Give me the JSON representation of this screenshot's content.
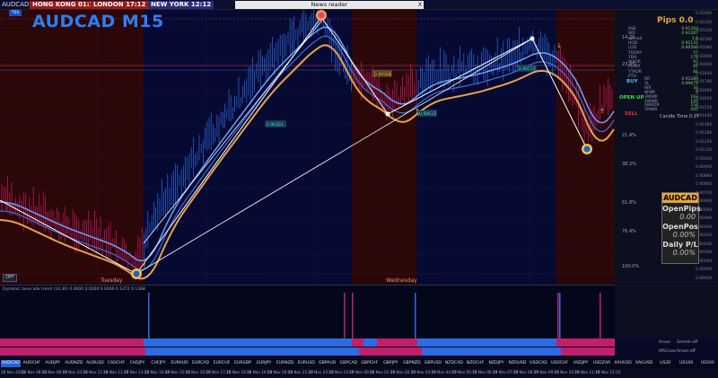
{
  "window": {
    "symbol_label": "AUDCAD,M15",
    "small_tab": "TSS"
  },
  "clocks": {
    "hong_kong": "HONG KONG 01:12",
    "london": "LONDON  17:12",
    "new_york": "NEW YORK  12:12"
  },
  "news": {
    "label": "News reader",
    "close": "X"
  },
  "chart": {
    "title": "AUDCAD M15",
    "day_labels": [
      "Tuesday",
      "Wednesday"
    ],
    "off_button": "OFF",
    "box_labels": [
      "0.90303",
      "0.90568",
      "0.90633",
      "0.90572"
    ],
    "price_ticks": [
      "0.92400",
      "0.92320",
      "0.92240",
      "0.92160",
      "0.92080",
      "0.92000",
      "0.91920",
      "0.91840",
      "0.91760",
      "0.91680",
      "0.91600",
      "0.91520",
      "0.91440",
      "0.91360",
      "0.91280",
      "0.91200",
      "0.91120",
      "0.91040",
      "0.90960",
      "0.90880",
      "0.90800",
      "0.90720",
      "0.90640",
      "0.90560",
      "0.90480",
      "0.90400",
      "0.90320",
      "0.90240",
      "0.90160",
      "0.90080",
      "0.90000",
      "0.89920"
    ],
    "pct_ticks": [
      "14.25",
      "23.4%",
      "21.4%",
      "38.2%",
      "61.8%",
      "76.4%",
      "100.0%"
    ]
  },
  "info_panel": {
    "pips": "Pips 0.0",
    "rows": [
      {
        "k": "ASK",
        "v": "0.91303"
      },
      {
        "k": "BID",
        "v": "0.91287"
      },
      {
        "k": "spread",
        "v": "1.6"
      },
      {
        "k": "HOD",
        "v": "0.91131"
      },
      {
        "k": "LOD",
        "v": "0.90560"
      },
      {
        "k": "TODAY",
        "v": "57"
      },
      {
        "k": "YDR",
        "v": "172"
      },
      {
        "k": "WADR",
        "v": "97"
      },
      {
        "k": "MADR",
        "v": "81"
      },
      {
        "k": "YTADR",
        "v": "81"
      },
      {
        "k": "PTO",
        "v": "--"
      }
    ],
    "sl_rows": [
      {
        "k": "RR",
        "v": "0.91289"
      },
      {
        "k": "SL",
        "v": "0.89672"
      },
      {
        "k": "WR",
        "v": "34"
      },
      {
        "k": "WWR",
        "v": "0"
      },
      {
        "k": "3WWR",
        "v": "163"
      },
      {
        "k": "5WWR",
        "v": "156"
      },
      {
        "k": "SWADR",
        "v": "154"
      },
      {
        "k": "5MWR",
        "v": "205"
      }
    ],
    "signals": {
      "buy": "BUY",
      "open_up": "OPEN UP",
      "sell": "SELL"
    },
    "candle_time_label": "Candle Time",
    "candle_time_value": "0:27"
  },
  "account": {
    "symbol": "AUDCAD",
    "open_pips_label": "OpenPips",
    "open_pips_value": "0.00",
    "open_pos_label": "OpenPos",
    "open_pos_value": "0.00%",
    "daily_pl_label": "Daily P/L",
    "daily_pl_value": "0.00%"
  },
  "indicator": {
    "label": "Dynamic zone adx trend (14,30) 0.0000 0.0000 0.0000 0.1472 0.1388",
    "strip1_label": "Aroon",
    "strip1_right": "Sentek-off",
    "strip2_label": "MACross",
    "strip2_right": "Aroon-off"
  },
  "symbols": [
    "AUDCAD",
    "AUDCHF",
    "AUDJPY",
    "AUDNZD",
    "AUDUSD",
    "CADCHF",
    "CADJPY",
    "CHFJPY",
    "EURAUD",
    "EURCAD",
    "EURCHF",
    "EURGBP",
    "EURJPY",
    "EURNZD",
    "EURUSD",
    "GBPAUD",
    "GBPCAD",
    "GBPCHF",
    "GBPJPY",
    "GBPNZD",
    "GBPUSD",
    "NZDCAD",
    "NZDCHF",
    "NZDJPY",
    "NZDUSD",
    "USDCAD",
    "USDCHF",
    "USDJPY",
    "USDZAR",
    "XAUUSD",
    "XAGUSD",
    "US30",
    "US100",
    "US500"
  ],
  "dates": [
    "28 Nov 2023",
    "28 Nov 08:15",
    "28 Nov 09:15",
    "28 Nov 10:15",
    "28 Nov 11:15",
    "28 Nov 12:15",
    "28 Nov 13:15",
    "28 Nov 14:15",
    "28 Nov 15:15",
    "28 Nov 16:15",
    "28 Nov 17:15",
    "28 Nov 18:15",
    "28 Nov 19:15",
    "28 Nov 20:15",
    "28 Nov 21:15",
    "28 Nov 22:15",
    "28 Nov 23:15",
    "29 Nov 00:15",
    "29 Nov 01:15",
    "29 Nov 02:15",
    "29 Nov 03:15",
    "29 Nov 04:15",
    "29 Nov 05:15",
    "29 Nov 06:15",
    "29 Nov 07:15",
    "29 Nov 08:15",
    "29 Nov 09:15",
    "29 Nov 10:15",
    "29 Nov 11:15",
    "29 Nov 12:15"
  ],
  "colors": {
    "brand_blue": "#2f7ef0",
    "sell_zone": "#3a0a0a",
    "orange_band": "#e8a24a",
    "candle_blue": "#2e6be0",
    "candle_magenta": "#c0206a"
  }
}
